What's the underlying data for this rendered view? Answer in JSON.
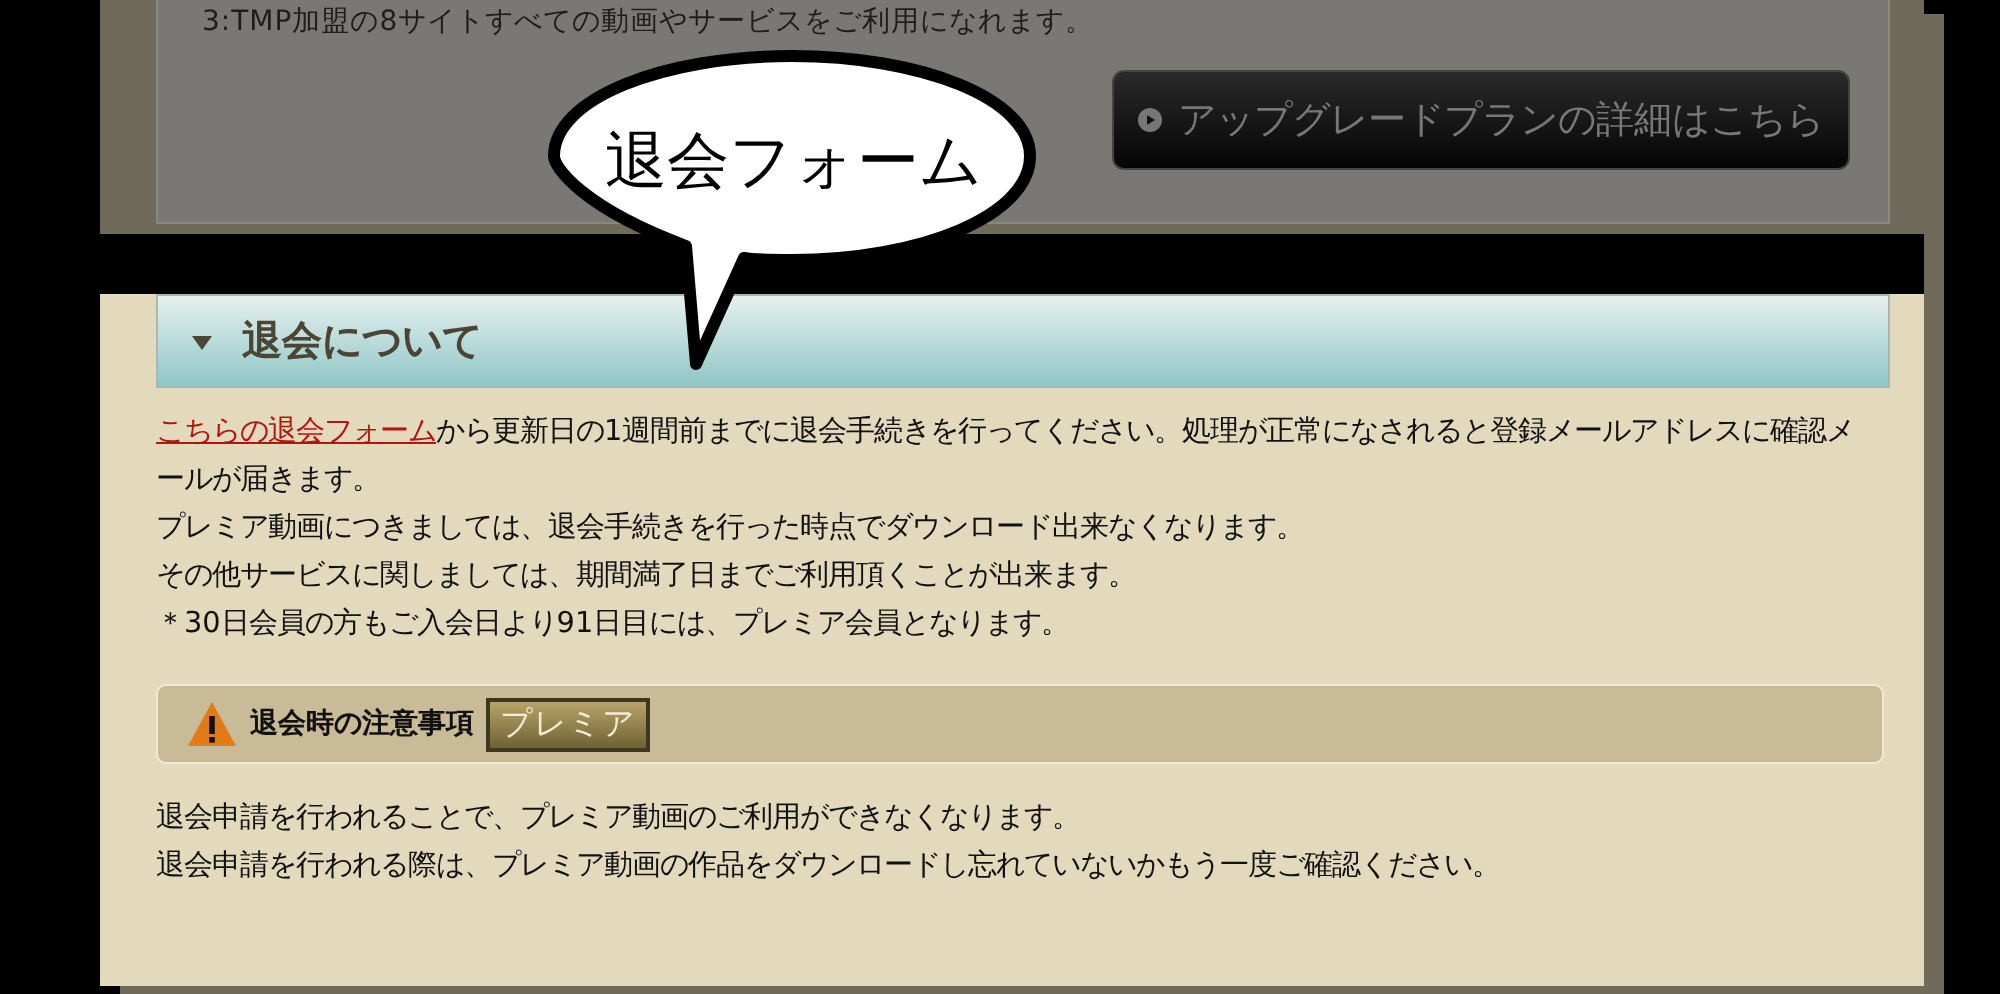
{
  "top_section": {
    "text": "3:TMP加盟の8サイトすべての動画やサービスをご利用になれます。",
    "upgrade_button": "アップグレードプランの詳細はこちら"
  },
  "callout": {
    "text": "退会フォーム"
  },
  "section": {
    "title": "退会について",
    "expanded": true,
    "paragraphs": [
      {
        "link": "こちらの退会フォーム",
        "text": "から更新日の1週間前までに退会手続きを行ってください。処理が正常になされると登録メールアドレスに確認メールが届きます。"
      },
      {
        "text": "プレミア動画につきましては、退会手続きを行った時点でダウンロード出来なくなります。"
      },
      {
        "text": "その他サービスに関しましては、期間満了日までご利用頂くことが出来ます。"
      },
      {
        "text": "＊30日会員の方もご入会日より91日目には、プレミア会員となります。"
      }
    ]
  },
  "notice": {
    "title": "退会時の注意事項",
    "badge": "プレミア",
    "lines": [
      "退会申請を行われることで、プレミア動画のご利用ができなくなります。",
      "退会申請を行われる際は、プレミア動画の作品をダウンロードし忘れていないかもう一度ご確認ください。"
    ]
  }
}
